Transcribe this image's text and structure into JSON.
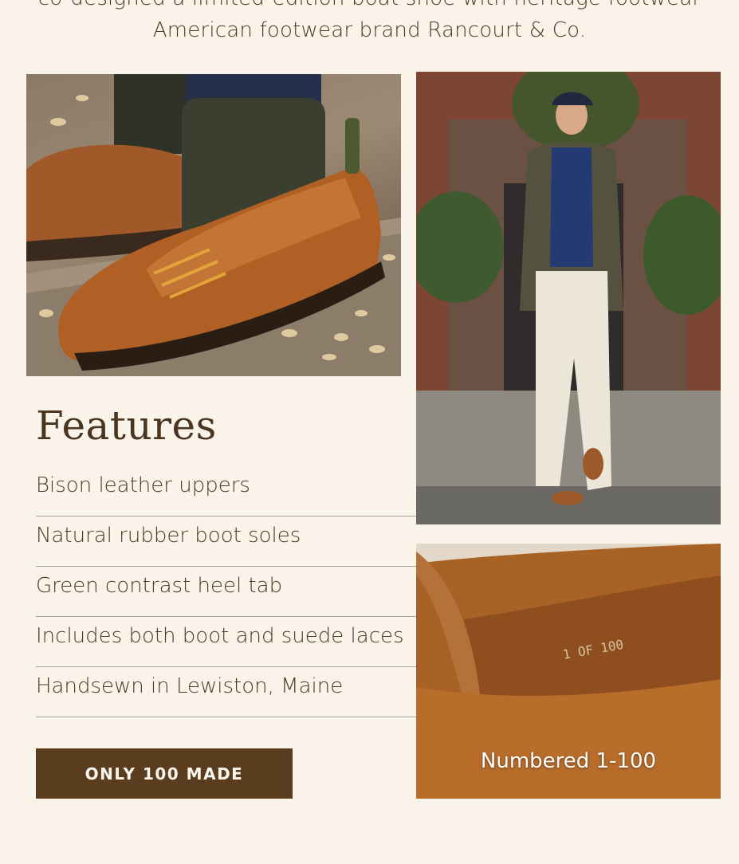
{
  "intro": {
    "line1": "co-designed a limited-edition boat shoe with heritage footwear",
    "line2": "American footwear brand Rancourt & Co."
  },
  "images": {
    "shoe_closeup": "bison-leather-boat-shoe-photo",
    "model": "man-walking-in-boat-shoes-photo",
    "insole": "numbered-insole-photo"
  },
  "features": {
    "title": "Features",
    "items": [
      "Bison leather uppers",
      "Natural rubber boot soles",
      "Green contrast heel tab",
      "Includes both boot and suede laces",
      "Handsewn in Lewiston, Maine"
    ]
  },
  "cta": {
    "label": "ONLY 100 MADE"
  },
  "insole_caption": "Numbered 1-100",
  "colors": {
    "background": "#f9f3ea",
    "text": "#4b3a26",
    "button": "#5a3d1e",
    "divider": "#a2a299"
  }
}
